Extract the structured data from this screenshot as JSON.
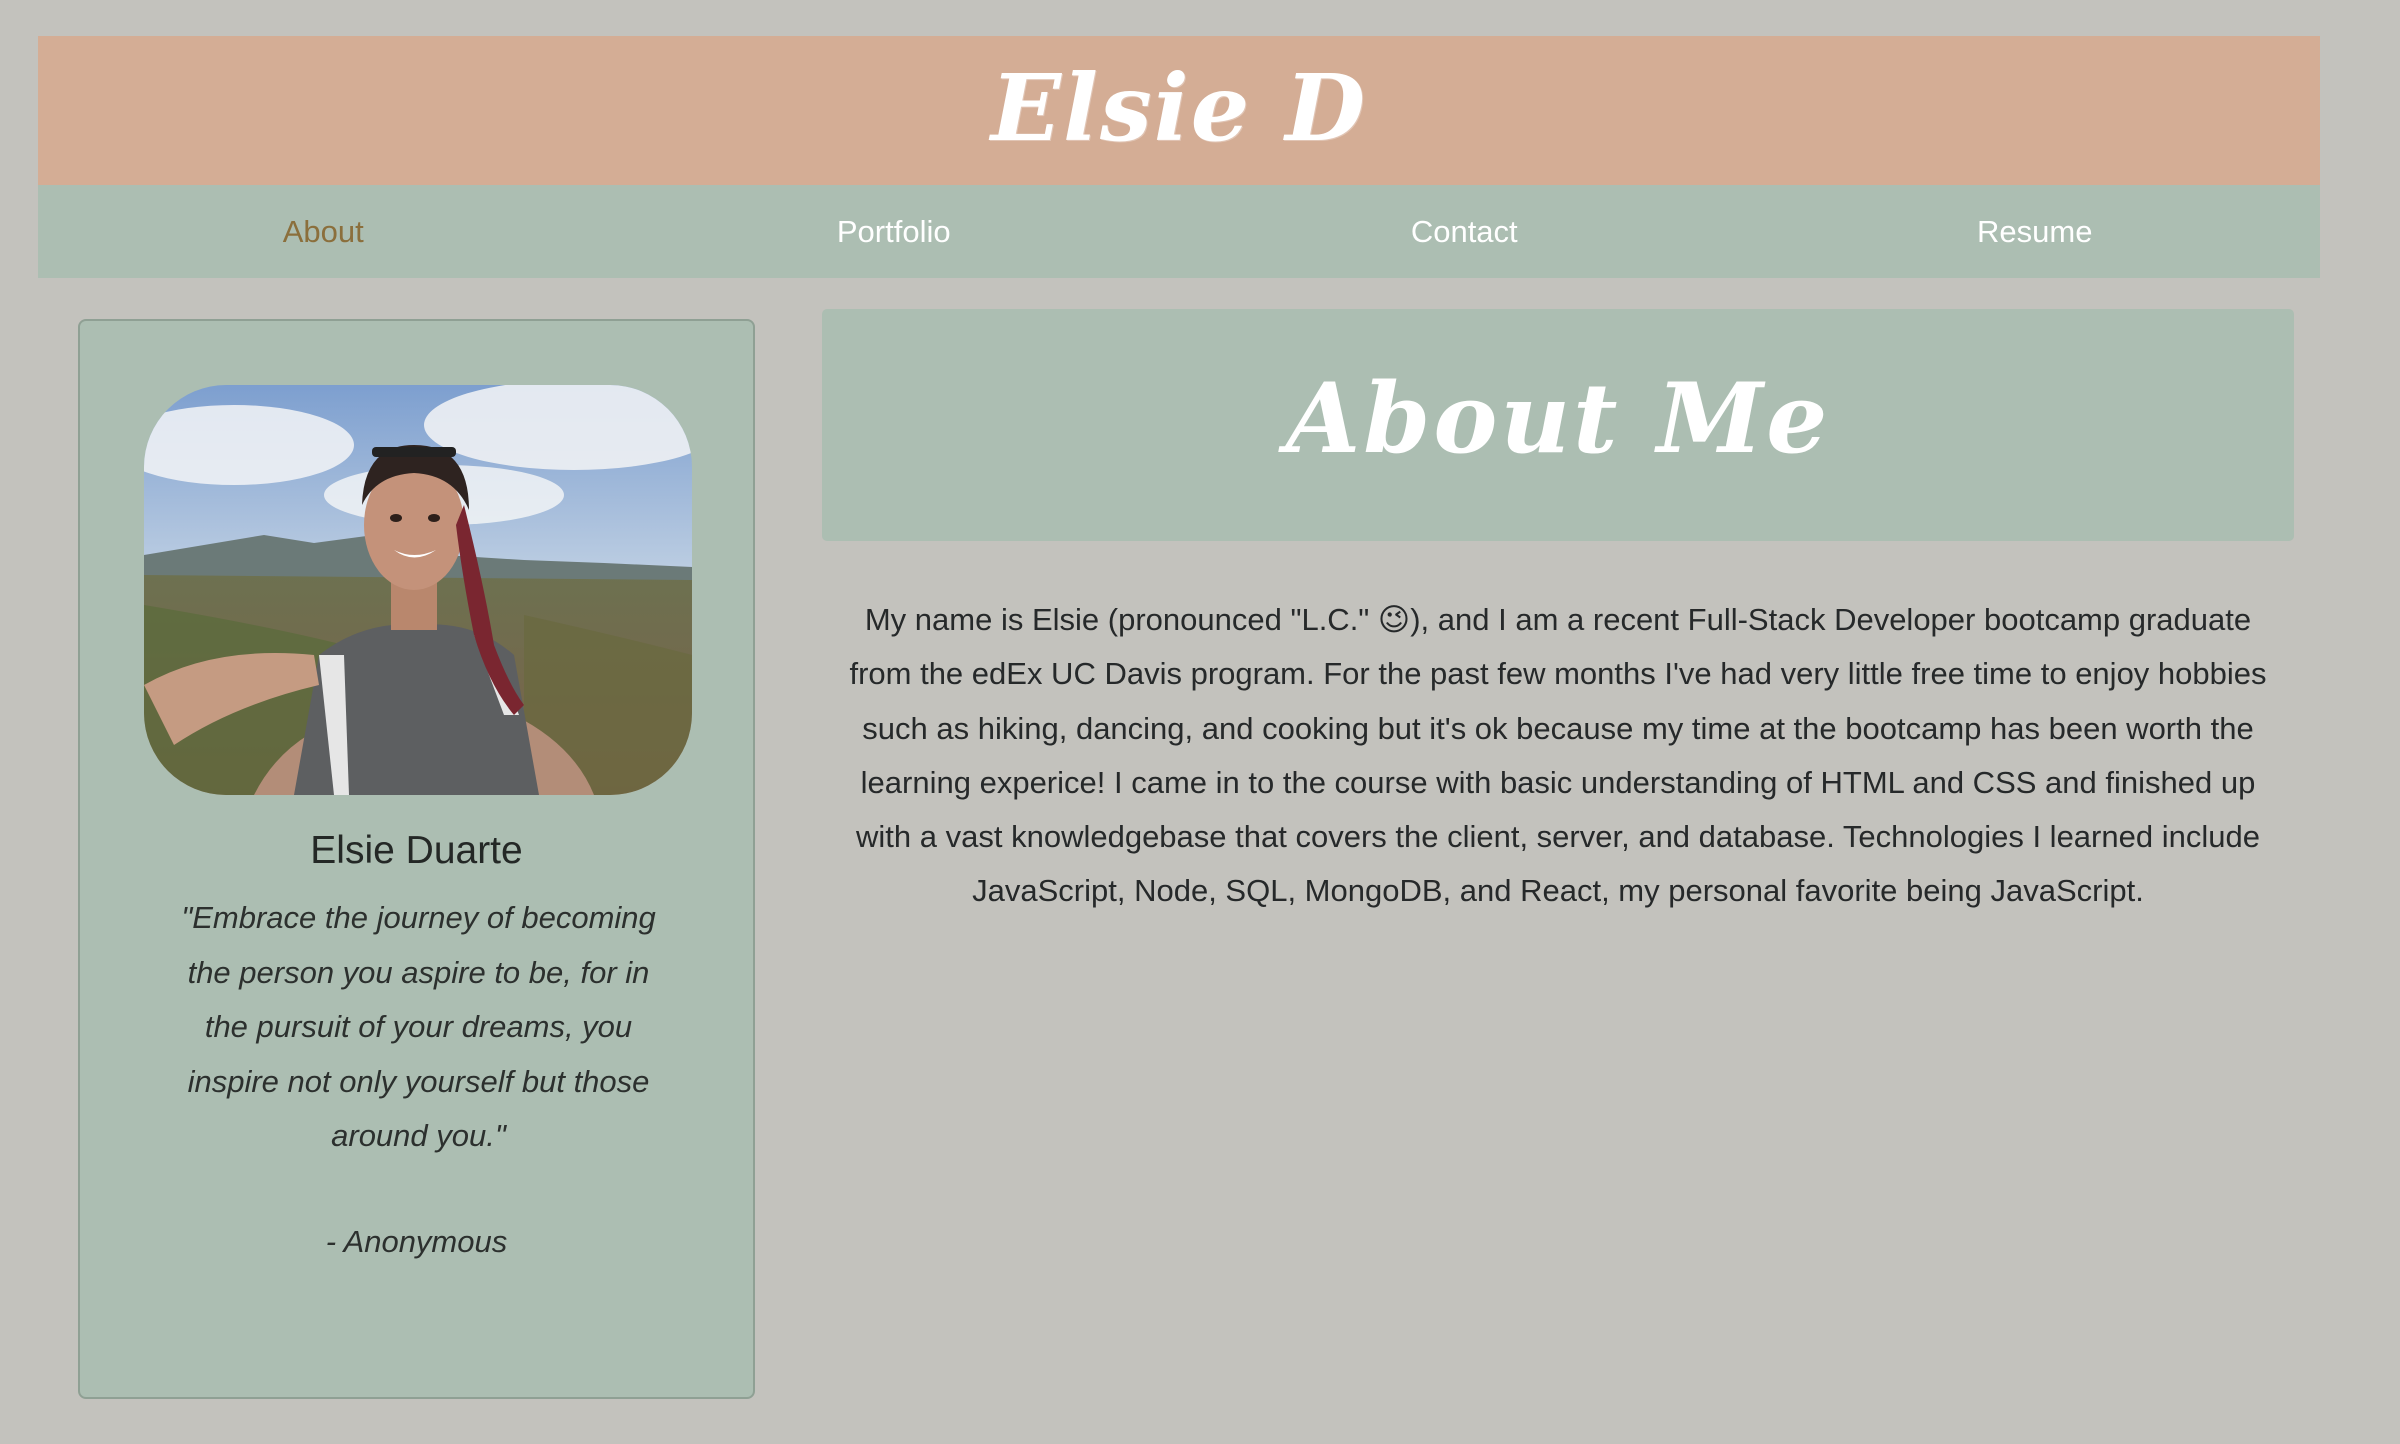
{
  "header": {
    "site_title": "Elsie D"
  },
  "nav": {
    "items": [
      {
        "label": "About",
        "active": true
      },
      {
        "label": "Portfolio",
        "active": false
      },
      {
        "label": "Contact",
        "active": false
      },
      {
        "label": "Resume",
        "active": false
      }
    ]
  },
  "profile": {
    "photo_icon": "profile-photo",
    "name": "Elsie Duarte",
    "quote": "\"Embrace the journey of becoming the person you aspire to be, for in the pursuit of your dreams, you inspire not only yourself but those around you.\"",
    "attribution": "- Anonymous"
  },
  "about": {
    "title": "About Me",
    "body": "My name is Elsie (pronounced \"L.C.\" 😉), and I am a recent Full-Stack Developer bootcamp graduate from the edEx UC Davis program. For the past few months I've had very little free time to enjoy hobbies such as hiking, dancing, and cooking but it's ok because my time at the bootcamp has been worth the learning experice! I came in to the course with basic understanding of HTML and CSS and finished up with a vast knowledgebase that covers the client, server, and database. Technologies I learned include JavaScript, Node, SQL, MongoDB, and React, my personal favorite being JavaScript."
  },
  "colors": {
    "page_background": "#c3c2bd",
    "header_background": "#d4ad95",
    "panel_background": "#acbeb2",
    "nav_active_text": "#8b6f3c",
    "nav_text": "#ffffff"
  }
}
